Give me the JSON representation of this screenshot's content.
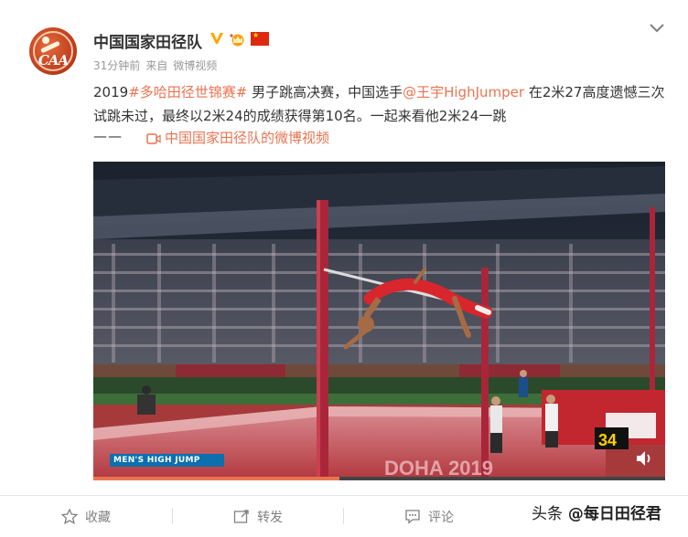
{
  "account": {
    "name": "中国国家田径队",
    "avatar_text": "CAA",
    "verified_icon": "verified-v-icon",
    "crown_icon": "crown-icon",
    "flag_icon": "china-flag-icon"
  },
  "meta": {
    "time": "31分钟前",
    "from_label": "来自",
    "source": "微博视频"
  },
  "post": {
    "year": "2019",
    "hashtag": "#多哈田径世锦赛#",
    "text_a": " 男子跳高决赛，中国选手",
    "mention": "@王宇HighJumper",
    "text_b": " 在2米27高度遗憾三次试跳未过，最终以2米24的成绩获得第10名。一起来看他2米24一跳",
    "dash": "——",
    "video_link": "中国国家田径队的微博视频"
  },
  "video": {
    "caption": "MEN'S HIGH JUMP",
    "bib_number": "34",
    "venue_text": "DOHA 2019",
    "progress": 0.43
  },
  "actions": [
    {
      "label": "收藏",
      "icon": "star-icon"
    },
    {
      "label": "转发",
      "icon": "repost-icon"
    },
    {
      "label": "评论",
      "icon": "comment-icon"
    }
  ],
  "watermark": {
    "platform": "头条",
    "handle": "@每日田径君"
  },
  "colors": {
    "link": "#eb7350",
    "verified": "#ffa500",
    "progress": "#eb7350"
  }
}
